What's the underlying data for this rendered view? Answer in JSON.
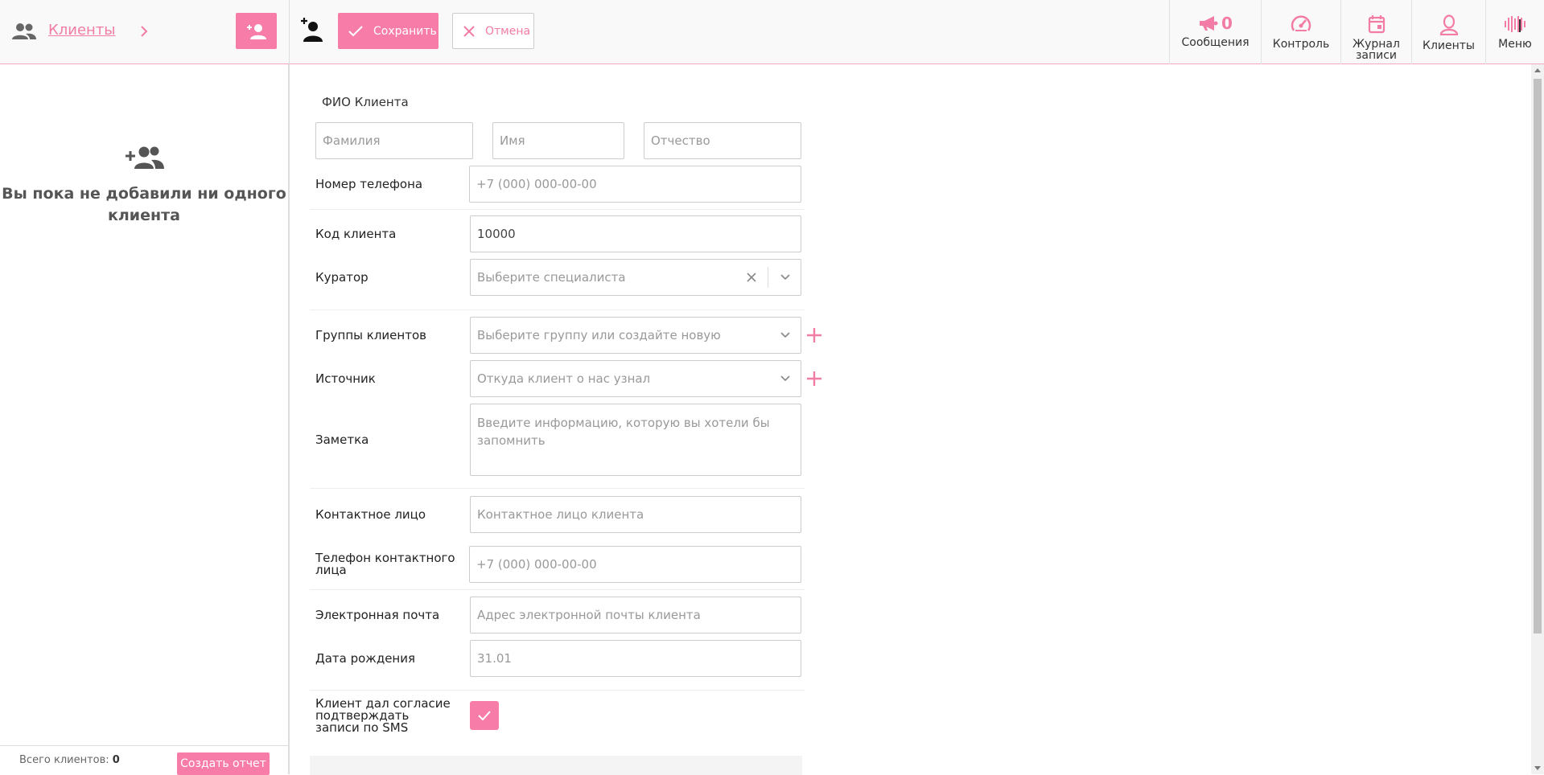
{
  "colors": {
    "accent": "#f87ca8",
    "link": "#f27ca5"
  },
  "header": {
    "clients_link": "Клиенты",
    "save_label": "Сохранить",
    "cancel_label": "Отмена",
    "nav": {
      "messages_label": "Сообщения",
      "messages_count": "0",
      "control_label": "Контроль",
      "journal_label": "Журнал\nзаписи",
      "clients_label": "Клиенты",
      "menu_label": "Меню"
    }
  },
  "sidebar": {
    "empty_text": "Вы пока не добавили ни одного клиента",
    "total_label": "Всего клиентов:",
    "total_value": "0",
    "report_button": "Создать отчет"
  },
  "form": {
    "fio_title": "ФИО Клиента",
    "surname_placeholder": "Фамилия",
    "name_placeholder": "Имя",
    "patronymic_placeholder": "Отчество",
    "phone_label": "Номер телефона",
    "phone_placeholder": "+7 (000) 000-00-00",
    "code_label": "Код клиента",
    "code_value": "10000",
    "curator_label": "Куратор",
    "curator_placeholder": "Выберите специалиста",
    "groups_label": "Группы клиентов",
    "groups_placeholder": "Выберите группу или создайте новую",
    "source_label": "Источник",
    "source_placeholder": "Откуда клиент о нас узнал",
    "note_label": "Заметка",
    "note_placeholder": "Введите информацию, которую вы хотели бы запомнить",
    "contact_label": "Контактное лицо",
    "contact_placeholder": "Контактное лицо клиента",
    "contact_phone_label": "Телефон контактного лица",
    "contact_phone_placeholder": "+7 (000) 000-00-00",
    "email_label": "Электронная почта",
    "email_placeholder": "Адрес электронной почты клиента",
    "birthday_label": "Дата рождения",
    "birthday_placeholder": "31.01",
    "sms_consent_label": "Клиент дал согласие подтверждать записи по SMS",
    "sms_consent_checked": true
  }
}
